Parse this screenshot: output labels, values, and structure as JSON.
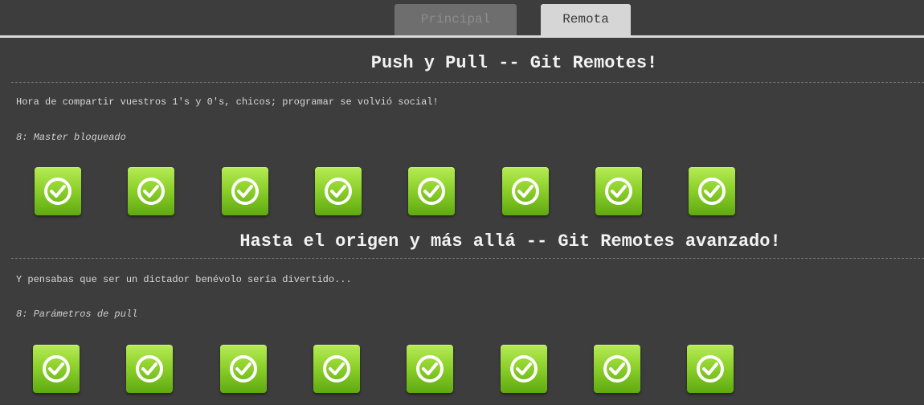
{
  "tabs": {
    "principal_label": "Principal",
    "remota_label": "Remota"
  },
  "sections": [
    {
      "title": "Push y Pull -- Git Remotes!",
      "description": "Hora de compartir vuestros 1's y 0's, chicos; programar se volvió social!",
      "level_status": "8: Master bloqueado",
      "levels": [
        "check-icon",
        "check-icon",
        "check-icon",
        "check-icon",
        "check-icon",
        "check-icon",
        "check-icon",
        "check-icon"
      ]
    },
    {
      "title": "Hasta el origen y más allá -- Git Remotes avanzado!",
      "description": "Y pensabas que ser un dictador benévolo sería divertido...",
      "level_status": "8: Parámetros de pull",
      "levels": [
        "check-icon",
        "check-icon",
        "check-icon",
        "check-icon",
        "check-icon",
        "check-icon",
        "check-icon",
        "check-icon"
      ]
    }
  ],
  "colors": {
    "background": "#3d3d3d",
    "accent_green": "#8ed12c",
    "active_tab": "#d6d6d6",
    "inactive_tab": "#6e6e6e"
  }
}
